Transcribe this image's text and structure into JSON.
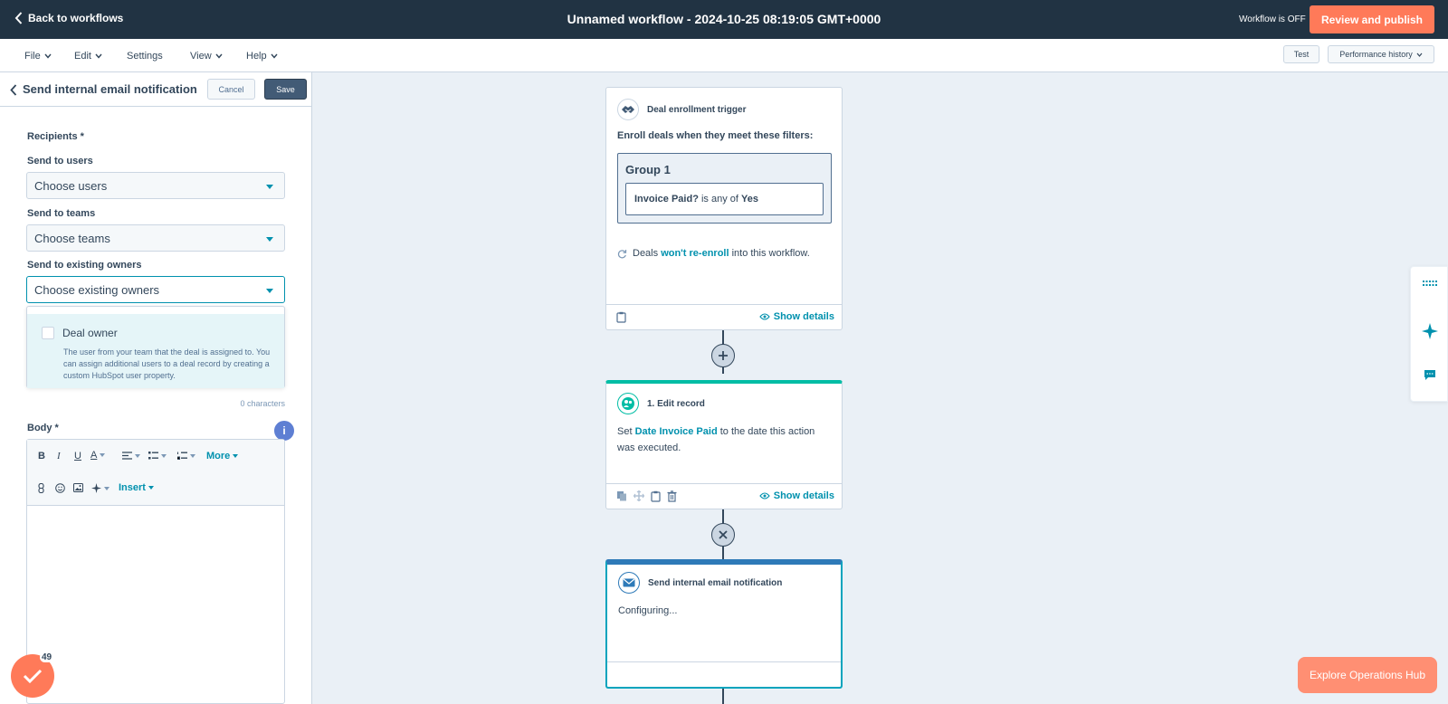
{
  "topbar": {
    "back_label": "Back to workflows",
    "title": "Unnamed workflow - 2024-10-25 08:19:05 GMT+0000",
    "status": "Workflow is OFF",
    "publish_label": "Review and publish"
  },
  "menu": {
    "items": [
      "File",
      "Edit",
      "Settings",
      "View",
      "Help"
    ],
    "test_label": "Test",
    "performance_label": "Performance history"
  },
  "panel": {
    "title": "Send internal email notification",
    "cancel_label": "Cancel",
    "save_label": "Save",
    "recipients_label": "Recipients *",
    "users_label": "Send to users",
    "users_value": "Choose users",
    "teams_label": "Send to teams",
    "teams_value": "Choose teams",
    "owners_label": "Send to existing owners",
    "owners_value": "Choose existing owners",
    "option_label": "Deal owner",
    "option_desc": "The user from your team that the deal is assigned to. You can assign additional users to a deal record by creating a custom HubSpot user property.",
    "char_count": "0 characters",
    "body_label": "Body *",
    "info_badge": "i",
    "toolbar": {
      "bold": "B",
      "italic": "I",
      "underline": "U",
      "text_color": "A",
      "more": "More",
      "insert": "Insert"
    }
  },
  "canvas": {
    "trigger": {
      "title": "Deal enrollment trigger",
      "intro": "Enroll deals when they meet these filters:",
      "group_title": "Group 1",
      "filter_property": "Invoice Paid?",
      "filter_op": " is any of ",
      "filter_value": "Yes",
      "reenroll_prefix": "Deals ",
      "reenroll_link": "won't re-enroll",
      "reenroll_suffix": " into this workflow.",
      "show_details": "Show details"
    },
    "edit_record": {
      "title": "1. Edit record",
      "text_prefix": "Set ",
      "text_link": "Date Invoice Paid",
      "text_suffix": " to the date this action was executed.",
      "show_details": "Show details"
    },
    "email_action": {
      "title": "Send internal email notification",
      "status": "Configuring..."
    }
  },
  "widgets": {
    "explore_label": "Explore Operations Hub",
    "onboarding_count": "49"
  },
  "colors": {
    "topbar_bg": "#213343",
    "accent_orange": "#ff7a59",
    "teal_link": "#0091ae",
    "edit_record_accent": "#00bda5",
    "email_accent": "#2e7ab8"
  }
}
